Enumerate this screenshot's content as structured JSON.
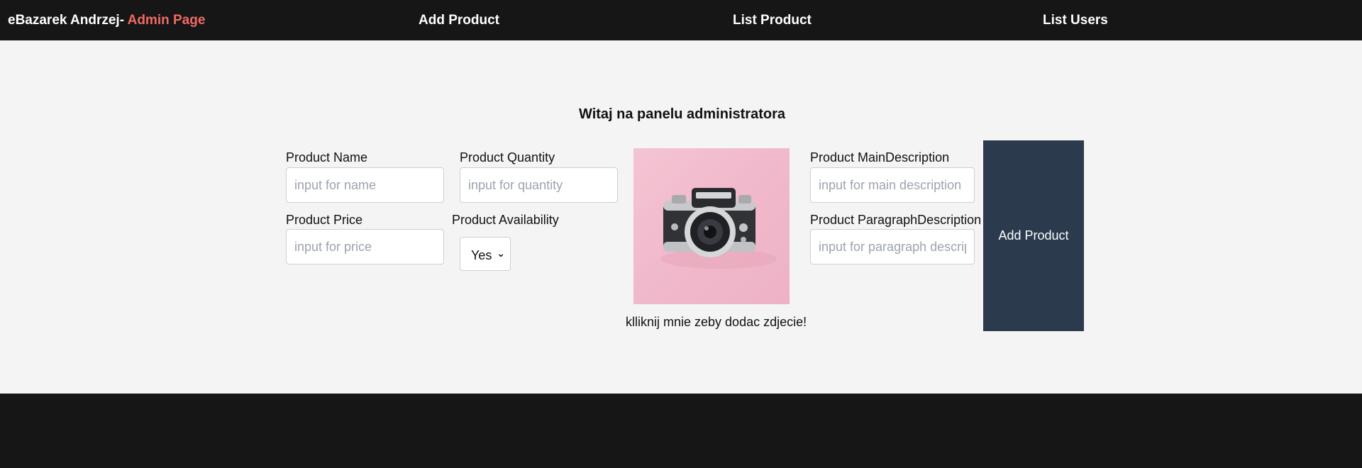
{
  "nav": {
    "brand_prefix": "eBazarek Andrzej- ",
    "brand_accent": "Admin Page",
    "add_product": "Add Product",
    "list_product": "List Product",
    "list_users": "List Users"
  },
  "main": {
    "welcome": "Witaj na panelu administratora",
    "product_name_label": "Product Name",
    "product_name_placeholder": "input for name",
    "product_quantity_label": "Product Quantity",
    "product_quantity_placeholder": "input for quantity",
    "product_price_label": "Product Price",
    "product_price_placeholder": "input for price",
    "product_availability_label": "Product Availability",
    "availability_selected": "Yes",
    "photo_caption": "klliknij mnie zeby dodac zdjecie!",
    "main_description_label": "Product MainDescription",
    "main_description_placeholder": "input for main description",
    "paragraph_description_label": "Product ParagraphDescription",
    "paragraph_description_placeholder": "input for paragraph description",
    "submit_label": "Add Product"
  },
  "colors": {
    "navbar_bg": "#161616",
    "brand_accent": "#f06a63",
    "button_bg": "#2b3a4d",
    "page_bg": "#f4f4f4"
  },
  "icons": {
    "photo": "camera-photo",
    "select": "chevron-down-icon"
  }
}
